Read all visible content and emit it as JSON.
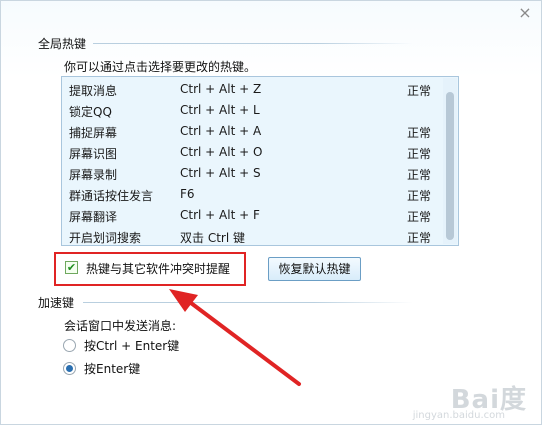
{
  "dialog": {
    "close_glyph": "×"
  },
  "global_hotkeys": {
    "section_title": "全局热键",
    "hint": "你可以通过点击选择要更改的热键。",
    "rows": [
      {
        "name": "提取消息",
        "key": "Ctrl + Alt + Z",
        "status": "正常"
      },
      {
        "name": "锁定QQ",
        "key": "Ctrl + Alt + L",
        "status": ""
      },
      {
        "name": "捕捉屏幕",
        "key": "Ctrl + Alt + A",
        "status": "正常"
      },
      {
        "name": "屏幕识图",
        "key": "Ctrl + Alt + O",
        "status": "正常"
      },
      {
        "name": "屏幕录制",
        "key": "Ctrl + Alt + S",
        "status": "正常"
      },
      {
        "name": "群通话按住发言",
        "key": "F6",
        "status": "正常"
      },
      {
        "name": "屏幕翻译",
        "key": "Ctrl + Alt + F",
        "status": "正常"
      },
      {
        "name": "开启划词搜索",
        "key": "双击 Ctrl 键",
        "status": "正常"
      }
    ],
    "conflict_checkbox": {
      "label": "热键与其它软件冲突时提醒",
      "checked": true,
      "check_glyph": "✔"
    },
    "restore_button": "恢复默认热键"
  },
  "accelerator": {
    "section_title": "加速键",
    "send_label": "会话窗口中发送消息:",
    "options": [
      {
        "label": "按Ctrl + Enter键",
        "checked": false
      },
      {
        "label": "按Enter键",
        "checked": true
      }
    ]
  },
  "watermark": {
    "brand": "Bai度",
    "sub": "jingyan.baidu.com"
  },
  "annotation": {
    "box_color": "#e02424",
    "arrow_color": "#e02424"
  }
}
